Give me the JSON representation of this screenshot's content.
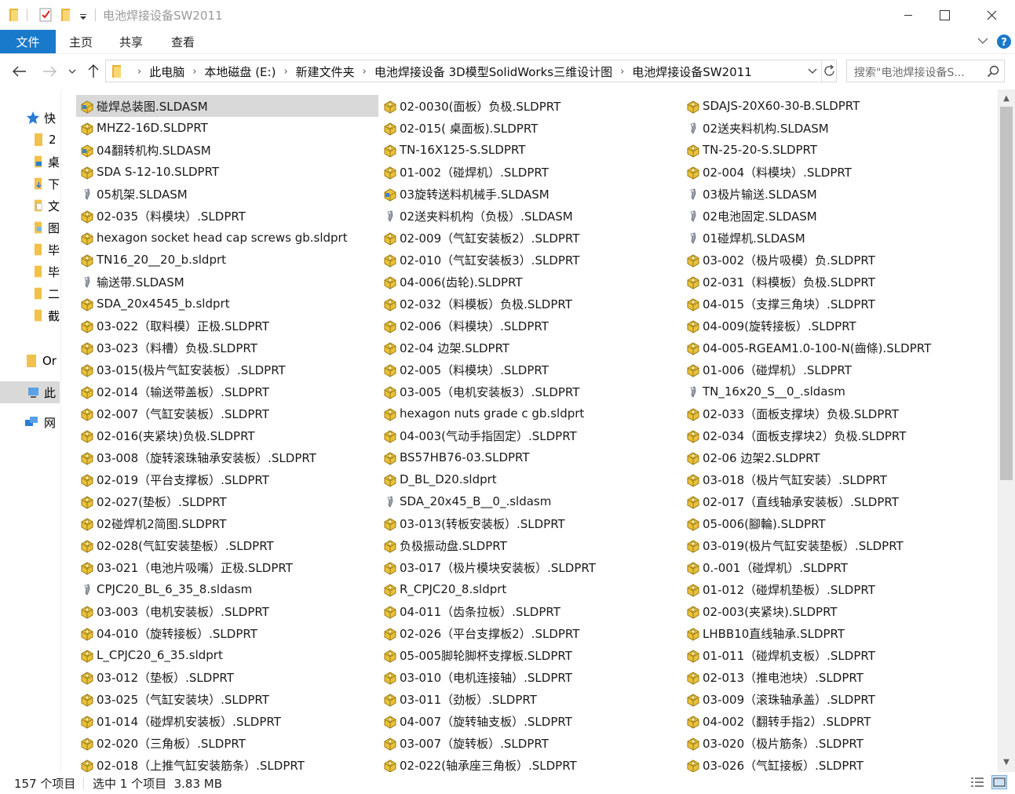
{
  "window": {
    "title": "电池焊接设备SW2011"
  },
  "ribbon": {
    "file_tab": "文件",
    "tabs": [
      "主页",
      "共享",
      "查看"
    ]
  },
  "address": {
    "crumbs": [
      "此电脑",
      "本地磁盘 (E:)",
      "新建文件夹",
      "电池焊接设备 3D模型SolidWorks三维设计图",
      "电池焊接设备SW2011"
    ]
  },
  "search": {
    "placeholder": "搜索\"电池焊接设备S..."
  },
  "nav": {
    "items": [
      "快",
      "2",
      "桌",
      "下",
      "文",
      "图",
      "毕",
      "毕",
      "二",
      "截",
      "Or",
      "此",
      "网"
    ]
  },
  "files": {
    "col1": [
      "碰焊总装图.SLDASM",
      "MHZ2-16D.SLDPRT",
      "04翻转机构.SLDASM",
      "SDA S-12-10.SLDPRT",
      "05机架.SLDASM",
      "02-035（料模块）.SLDPRT",
      "hexagon socket head cap screws gb.sldprt",
      "TN16_20__20_b.sldprt",
      "输送带.SLDASM",
      "SDA_20x4545_b.sldprt",
      "03-022（取料模）正极.SLDPRT",
      "03-023（料槽）负极.SLDPRT",
      "03-015(极片气缸安装板）.SLDPRT",
      "02-014（输送带盖板）.SLDPRT",
      "02-007（气缸安装板）.SLDPRT",
      "02-016(夹紧块)负极.SLDPRT",
      "03-008（旋转滚珠轴承安装板）.SLDPRT",
      "02-019（平台支撑板）.SLDPRT",
      "02-027(垫板）.SLDPRT",
      "02碰焊机2简图.SLDPRT",
      "02-028(气缸安装垫板）.SLDPRT",
      "03-021（电池片吸嘴）正极.SLDPRT",
      "CPJC20_BL_6_35_8.sldasm",
      "03-003（电机安装板）.SLDPRT",
      "04-010（旋转接板）.SLDPRT",
      "L_CPJC20_6_35.sldprt",
      "03-012（垫板）.SLDPRT",
      "03-025（气缸安装块）.SLDPRT",
      "01-014（碰焊机安装板）.SLDPRT",
      "02-020（三角板）.SLDPRT",
      "02-018（上推气缸安装筋条）.SLDPRT"
    ],
    "col2": [
      "02-0030(面板）负极.SLDPRT",
      "02-015( 桌面板).SLDPRT",
      "TN-16X125-S.SLDPRT",
      "01-002（碰焊机）.SLDPRT",
      "03旋转送料机械手.SLDASM",
      "02送夹料机构（负极）.SLDASM",
      "02-009（气缸安装板2）.SLDPRT",
      "02-010（气缸安装板3）.SLDPRT",
      "04-006(齿轮).SLDPRT",
      "02-032（料模板）负极.SLDPRT",
      "02-006（料模块）.SLDPRT",
      "02-04 边架.SLDPRT",
      "02-005（料模块）.SLDPRT",
      "03-005（电机安装板3）.SLDPRT",
      "hexagon nuts grade c gb.sldprt",
      "04-003(气动手指固定）.SLDPRT",
      "BS57HB76-03.SLDPRT",
      "D_BL_D20.sldprt",
      "SDA_20x45_B__0_.sldasm",
      "03-013(转板安装板）.SLDPRT",
      "负极振动盘.SLDPRT",
      "03-017（极片模块安装板）.SLDPRT",
      "R_CPJC20_8.sldprt",
      "04-011（齿条拉板）.SLDPRT",
      "02-026（平台支撑板2）.SLDPRT",
      "05-005脚轮脚杯支撑板.SLDPRT",
      "03-010（电机连接轴）.SLDPRT",
      "03-011（劲板）.SLDPRT",
      "04-007（旋转轴支板）.SLDPRT",
      "03-007（旋转板）.SLDPRT",
      "02-022(轴承座三角板）.SLDPRT"
    ],
    "col3": [
      "SDAJS-20X60-30-B.SLDPRT",
      "02送夹料机构.SLDASM",
      "TN-25-20-S.SLDPRT",
      "02-004（料模块）.SLDPRT",
      "03极片输送.SLDASM",
      "02电池固定.SLDASM",
      "01碰焊机.SLDASM",
      "03-002（极片吸模）负.SLDPRT",
      "02-031（料模板）负极.SLDPRT",
      "04-015（支撑三角块）.SLDPRT",
      "04-009(旋转接板）.SLDPRT",
      "04-005-RGEAM1.0-100-N(齒條).SLDPRT",
      "01-006（碰焊机）.SLDPRT",
      "TN_16x20_S__0_.sldasm",
      "02-033（面板支撑块）负极.SLDPRT",
      "02-034（面板支撑块2）负极.SLDPRT",
      "02-06 边架2.SLDPRT",
      "03-018（极片气缸安装）.SLDPRT",
      "02-017（直线轴承安装板）.SLDPRT",
      "05-006(腳輪).SLDPRT",
      "03-019(极片气缸安装垫板）.SLDPRT",
      "0.-001（碰焊机）.SLDPRT",
      "01-012（碰焊机垫板）.SLDPRT",
      "02-003(夹紧块).SLDPRT",
      "LHBB10直线轴承.SLDPRT",
      "01-011（碰焊机支板）.SLDPRT",
      "02-013（推电池块）.SLDPRT",
      "03-009（滚珠轴承盖）.SLDPRT",
      "04-002（翻转手指2）.SLDPRT",
      "03-020（极片筋条）.SLDPRT",
      "03-026（气缸接板）.SLDPRT"
    ]
  },
  "status": {
    "count": "157 个项目",
    "selection": "选中 1 个项目  3.83 MB"
  }
}
